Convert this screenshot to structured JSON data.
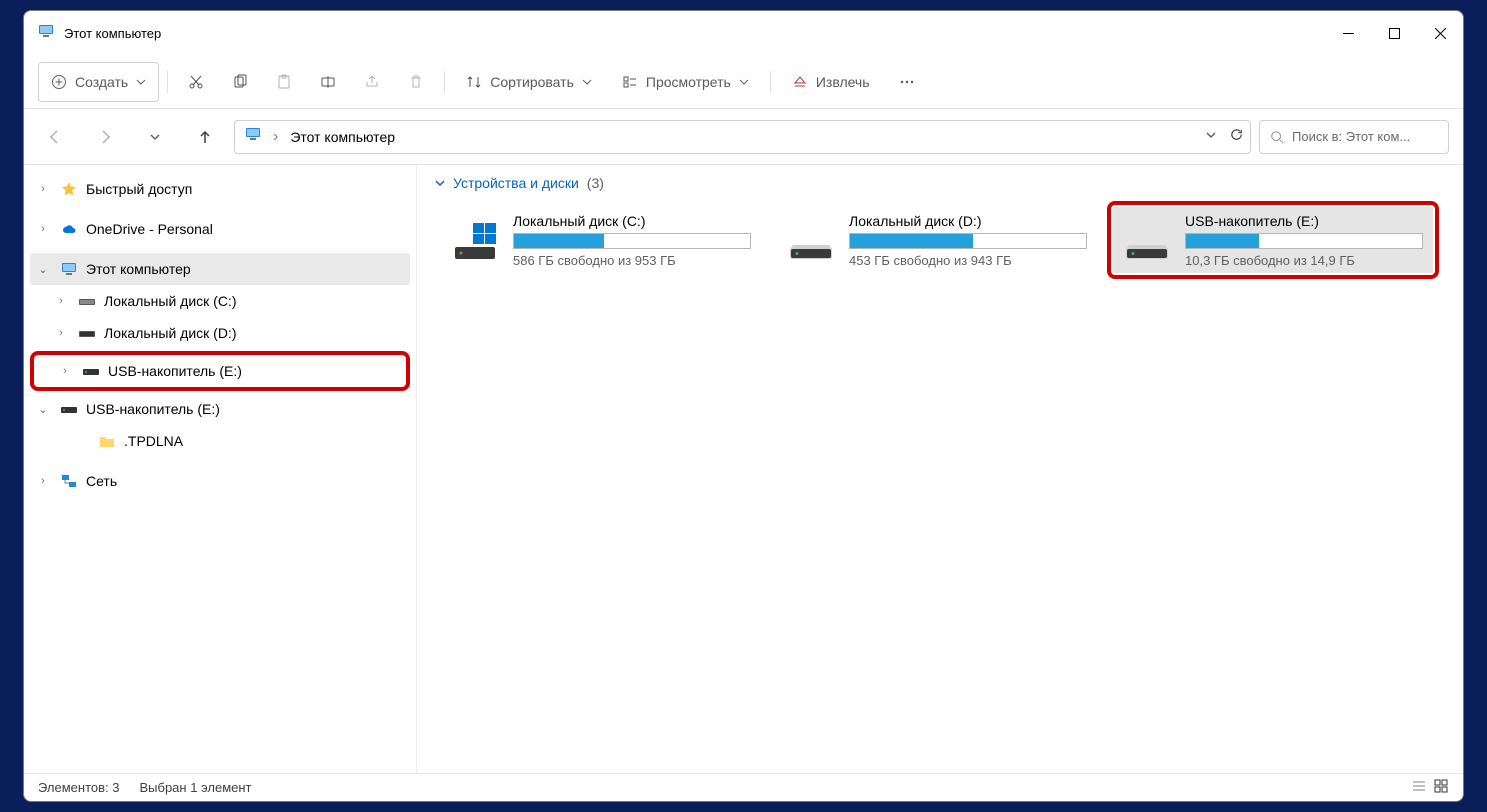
{
  "window": {
    "title": "Этот компьютер"
  },
  "toolbar": {
    "new_label": "Создать",
    "sort_label": "Сортировать",
    "view_label": "Просмотреть",
    "eject_label": "Извлечь"
  },
  "nav": {
    "breadcrumb_root": "Этот компьютер"
  },
  "search": {
    "placeholder": "Поиск в: Этот ком..."
  },
  "sidebar": {
    "quick_access": "Быстрый доступ",
    "onedrive": "OneDrive - Personal",
    "this_pc": "Этот компьютер",
    "local_c": "Локальный диск (C:)",
    "local_d": "Локальный диск (D:)",
    "usb_e": "USB-накопитель (E:)",
    "usb_e2": "USB-накопитель (E:)",
    "tpdlna": ".TPDLNA",
    "network": "Сеть"
  },
  "content": {
    "group_label": "Устройства и диски",
    "group_count": "(3)",
    "drives": [
      {
        "name": "Локальный диск (C:)",
        "free": "586 ГБ свободно из 953 ГБ",
        "fill_pct": 38,
        "type": "os"
      },
      {
        "name": "Локальный диск (D:)",
        "free": "453 ГБ свободно из 943 ГБ",
        "fill_pct": 52,
        "type": "hdd"
      },
      {
        "name": "USB-накопитель (E:)",
        "free": "10,3 ГБ свободно из 14,9 ГБ",
        "fill_pct": 31,
        "type": "usb",
        "selected": true,
        "highlight": true
      }
    ]
  },
  "status": {
    "items": "Элементов: 3",
    "selected": "Выбран 1 элемент"
  }
}
